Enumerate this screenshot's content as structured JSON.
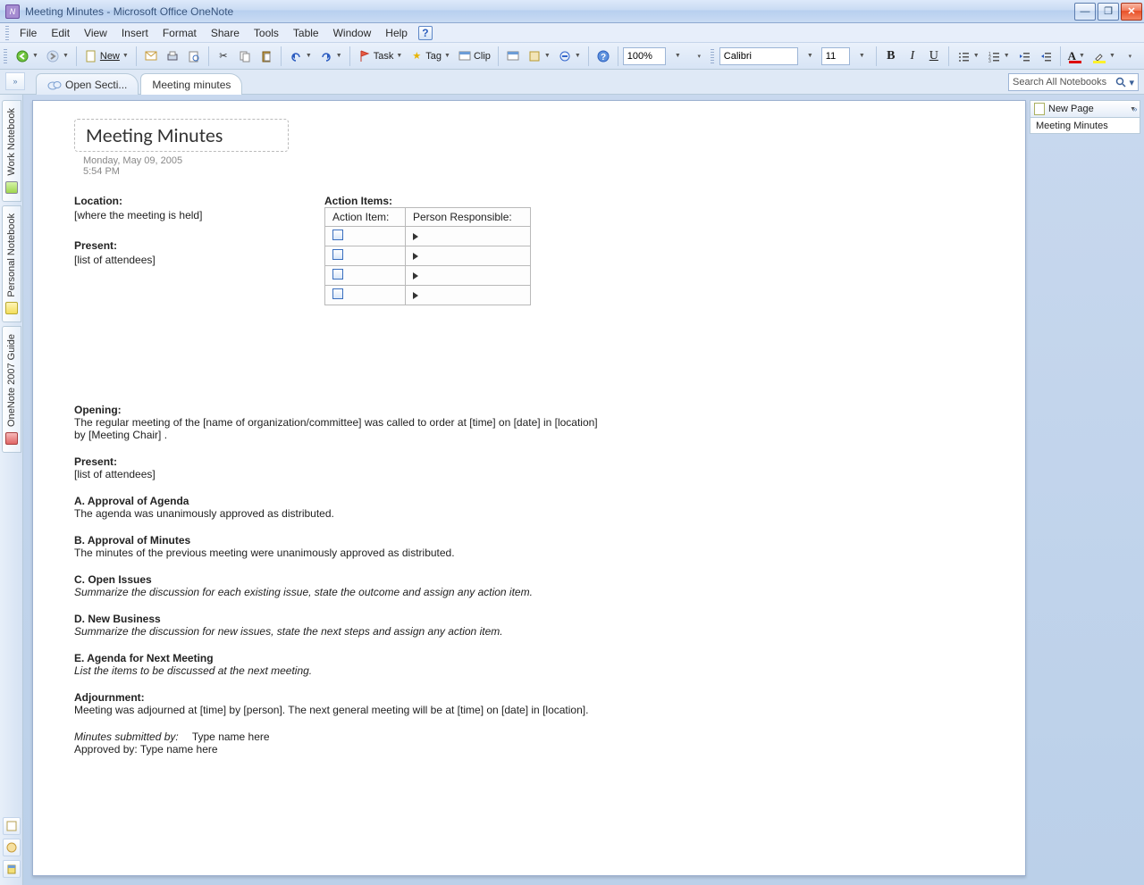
{
  "window": {
    "title": "Meeting Minutes - Microsoft Office OneNote"
  },
  "menu": {
    "items": [
      "File",
      "Edit",
      "View",
      "Insert",
      "Format",
      "Share",
      "Tools",
      "Table",
      "Window",
      "Help"
    ]
  },
  "toolbar": {
    "new_label": "New",
    "task_label": "Task",
    "tag_label": "Tag",
    "clip_label": "Clip",
    "zoom_value": "100%",
    "font_name": "Calibri",
    "font_size": "11"
  },
  "tabs": {
    "open_sections_label": "Open Secti...",
    "active_label": "Meeting minutes"
  },
  "search": {
    "placeholder": "Search All Notebooks"
  },
  "notebooks": {
    "items": [
      {
        "label": "Work Notebook",
        "color": "green"
      },
      {
        "label": "Personal Notebook",
        "color": "yellow"
      },
      {
        "label": "OneNote 2007 Guide",
        "color": "red"
      }
    ]
  },
  "page_pane": {
    "new_page_label": "New Page",
    "pages": [
      "Meeting Minutes"
    ]
  },
  "page": {
    "title": "Meeting Minutes",
    "date": "Monday, May 09, 2005",
    "time": "5:54 PM",
    "location_label": "Location:",
    "location_body": "[where the meeting is held]",
    "present_label": "Present:",
    "present_body": "[list of attendees]",
    "action_items_label": "Action Items:",
    "action_table": {
      "col1": "Action Item:",
      "col2": "Person Responsible:"
    },
    "opening_label": "Opening:",
    "opening_body": "The regular meeting of the [name of organization/committee]  was called to order at [time] on [date] in [location] by [Meeting Chair] .",
    "present2_label": "Present:",
    "present2_body": "[list of attendees]",
    "secA_head": "A.   Approval of Agenda",
    "secA_body": "The agenda was unanimously  approved as distributed.",
    "secB_head": "B.   Approval of Minutes",
    "secB_body": "The minutes of the previous meeting were unanimously  approved as distributed.",
    "secC_head": "C.   Open Issues",
    "secC_body": "Summarize the discussion for each existing issue, state the outcome and assign any action item.",
    "secD_head": "D.   New Business",
    "secD_body": "Summarize the discussion for new issues, state the next steps and assign any action item.",
    "secE_head": "E.   Agenda for Next Meeting",
    "secE_body": "List the items to be discussed at the next meeting.",
    "adj_label": "Adjournment:",
    "adj_body": "Meeting was adjourned at [time] by [person]. The next general meeting will be at [time] on [date] in [location].",
    "submitted_label": "Minutes submitted by:",
    "submitted_val": "Type name here",
    "approved_label": "Approved by:",
    "approved_val": "Type name here"
  }
}
